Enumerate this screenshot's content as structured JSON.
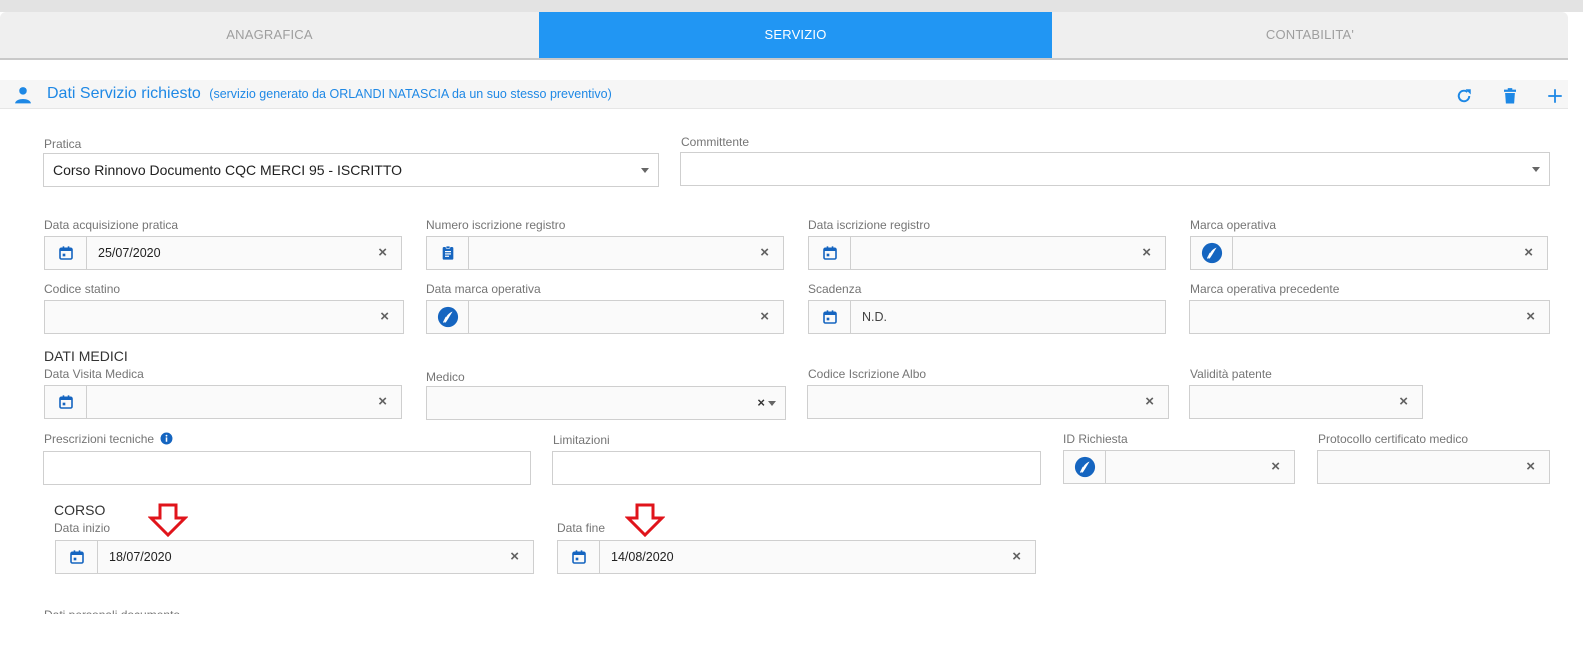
{
  "tabs": [
    "ANAGRAFICA",
    "SERVIZIO",
    "CONTABILITA'"
  ],
  "active_tab": "SERVIZIO",
  "section": {
    "title": "Dati Servizio richiesto",
    "subtitle": "(servizio generato da ORLANDI NATASCIA da un suo stesso preventivo)",
    "icons": [
      "person-icon",
      "refresh-icon",
      "trash-icon",
      "plus-icon"
    ]
  },
  "accent_color": "#2196f3",
  "form": {
    "pratica": {
      "label": "Pratica",
      "value": "Corso Rinnovo Documento CQC MERCI 95 - ISCRITTO"
    },
    "committente": {
      "label": "Committente",
      "value": ""
    },
    "data_acquisizione": {
      "label": "Data acquisizione pratica",
      "value": "25/07/2020"
    },
    "numero_iscrizione": {
      "label": "Numero iscrizione registro",
      "value": ""
    },
    "data_iscrizione": {
      "label": "Data iscrizione registro",
      "value": ""
    },
    "marca_operativa": {
      "label": "Marca operativa",
      "value": ""
    },
    "codice_statino": {
      "label": "Codice statino",
      "value": ""
    },
    "data_marca": {
      "label": "Data marca operativa",
      "value": ""
    },
    "scadenza": {
      "label": "Scadenza",
      "value": "N.D."
    },
    "marca_precedente": {
      "label": "Marca operativa precedente",
      "value": ""
    },
    "dati_medici": "DATI MEDICI",
    "data_visita": {
      "label": "Data Visita Medica",
      "value": ""
    },
    "medico": {
      "label": "Medico",
      "value": ""
    },
    "codice_albo": {
      "label": "Codice Iscrizione Albo",
      "value": ""
    },
    "validita_patente": {
      "label": "Validità patente",
      "value": ""
    },
    "prescrizioni": {
      "label": "Prescrizioni tecniche",
      "value": ""
    },
    "limitazioni": {
      "label": "Limitazioni",
      "value": ""
    },
    "id_richiesta": {
      "label": "ID Richiesta",
      "value": ""
    },
    "protocollo": {
      "label": "Protocollo certificato medico",
      "value": ""
    },
    "corso": "CORSO",
    "data_inizio": {
      "label": "Data inizio",
      "value": "18/07/2020"
    },
    "data_fine": {
      "label": "Data fine",
      "value": "14/08/2020"
    },
    "cut_label": "Dati personali documento"
  },
  "clear_glyph": "×",
  "annotation_color": "#e0141b"
}
